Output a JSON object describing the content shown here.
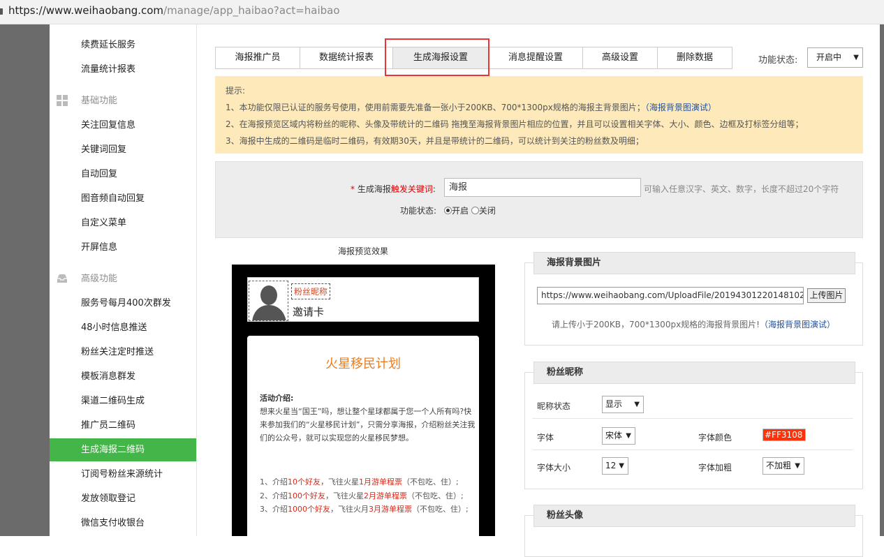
{
  "browser": {
    "url_host": "https://www.weihaobang.com",
    "url_path": "/manage/app_haibao?act=haibao"
  },
  "sidebar": {
    "top_items": [
      "续费延长服务",
      "流量统计报表"
    ],
    "section_basic": "基础功能",
    "basic_items": [
      "关注回复信息",
      "关键词回复",
      "自动回复",
      "图音频自动回复",
      "自定义菜单",
      "开屏信息"
    ],
    "section_advanced": "高级功能",
    "advanced_items": [
      "服务号每月400次群发",
      "48小时信息推送",
      "粉丝关注定时推送",
      "模板消息群发",
      "渠道二维码生成",
      "推广员二维码",
      "生成海报二维码",
      "订阅号粉丝来源统计",
      "发放领取登记",
      "微信支付收银台"
    ],
    "active_index": 6
  },
  "tabs": [
    "海报推广员",
    "数据统计报表",
    "生成海报设置",
    "消息提醒设置",
    "高级设置",
    "删除数据"
  ],
  "active_tab": 2,
  "function_status": {
    "label": "功能状态:",
    "value": "开启中"
  },
  "tips": {
    "title": "提示:",
    "line1": "1、本功能仅限已认证的服务号使用，使用前需要先准备一张小于200KB、700*1300px规格的海报主背景图片；",
    "line1_link": "（海报背景图演试）",
    "line1_end": "）",
    "line2": "2、在海报预览区域内将粉丝的昵称、头像及带统计的二维码 拖拽至海报背景图片相应的位置，并且可以设置相关字体、大小、颜色、边框及打标签分组等；",
    "line3": "3、海报中生成的二维码是临时二维码，有效期30天，并且是带统计的二维码，可以统计到关注的粉丝数及明细；"
  },
  "form": {
    "star": "*",
    "kw_label_a": "生成海报",
    "kw_label_b": "触发关键词",
    "kw_label_c": ":",
    "kw_value": "海报",
    "kw_hint": "可输入任意汉字、英文、数字，长度不超过20个字符",
    "status_label": "功能状态:",
    "opt_on": "开启",
    "opt_off": "关闭"
  },
  "preview": {
    "title": "海报预览效果",
    "nick": "粉丝昵称",
    "invite": "邀请卡",
    "poster_title": "火星移民计划",
    "intro_title": "活动介绍:",
    "intro_text": "想来火星当“国王”吗，想让整个星球都属于您一个人所有吗?快来参加我们的“火星移民计划”，只需分享海报，介绍粉丝关注我们的公众号，就可以实现您的火星移民梦想。",
    "list": [
      {
        "a": "1、介绍",
        "b": "10个好友",
        "c": "，飞往火星",
        "d": "1月游单程票",
        "e": "（不包吃、住）;"
      },
      {
        "a": "2、介绍",
        "b": "100个好友",
        "c": "，飞往火星",
        "d": "2月游单程票",
        "e": "（不包吃、住）;"
      },
      {
        "a": "3、介绍",
        "b": "1000个好友",
        "c": "，飞往火月",
        "d": "3月游单程票",
        "e": "（不包吃、住）;"
      }
    ]
  },
  "bg_panel": {
    "title": "海报背景图片",
    "url": "https://www.weihaobang.com/UploadFile/201943012201481026.j",
    "upload": "上传图片",
    "hint": "请上传小于200KB，700*1300px规格的海报背景图片!",
    "hint_link": "（海报背景图演试）"
  },
  "nick_panel": {
    "title": "粉丝昵称",
    "status_label": "昵称状态",
    "status_value": "显示",
    "font_label": "字体",
    "font_value": "宋体",
    "color_label": "字体颜色",
    "color_value": "#FF3108",
    "size_label": "字体大小",
    "size_value": "12",
    "bold_label": "字体加粗",
    "bold_value": "不加粗"
  },
  "avatar_panel": {
    "title": "粉丝头像"
  }
}
